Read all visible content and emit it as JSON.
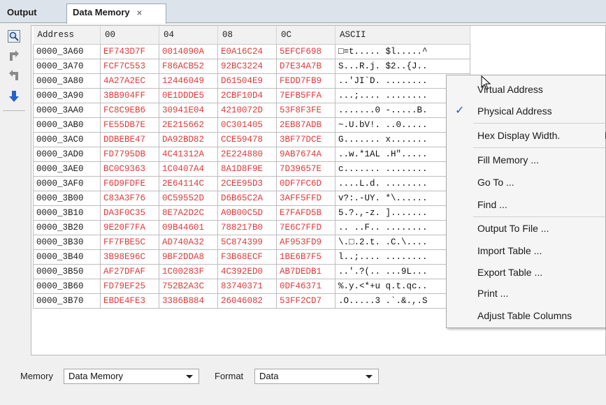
{
  "tabs": [
    {
      "label": "Output"
    },
    {
      "label": "Data Memory"
    }
  ],
  "close_glyph": "✕",
  "table": {
    "headers": [
      "Address",
      "00",
      "04",
      "08",
      "0C",
      "ASCII"
    ],
    "rows": [
      {
        "address": "0000_3A60",
        "c00": "EF743D7F",
        "c04": "0014090A",
        "c08": "E0A16C24",
        "c0c": "5EFCF698",
        "ascii": "□=t..... $l.....^"
      },
      {
        "address": "0000_3A70",
        "c00": "FCF7C553",
        "c04": "F86ACB52",
        "c08": "92BC3224",
        "c0c": "D7E34A7B",
        "ascii": "S...R.j. $2..{J.."
      },
      {
        "address": "0000_3A80",
        "c00": "4A27A2EC",
        "c04": "12446049",
        "c08": "D61504E9",
        "c0c": "FEDD7FB9",
        "ascii": "..'JI`D. ........"
      },
      {
        "address": "0000_3A90",
        "c00": "3BB904FF",
        "c04": "0E1DDDE5",
        "c08": "2CBF10D4",
        "c0c": "7EFB5FFA",
        "ascii": "...;.... ........"
      },
      {
        "address": "0000_3AA0",
        "c00": "FC8C9EB6",
        "c04": "30941E04",
        "c08": "4210072D",
        "c0c": "53F8F3FE",
        "ascii": ".......0 -.....B."
      },
      {
        "address": "0000_3AB0",
        "c00": "FE55DB7E",
        "c04": "2E215662",
        "c08": "0C301405",
        "c0c": "2EB87ADB",
        "ascii": "~.U.bV!. ..0....."
      },
      {
        "address": "0000_3AC0",
        "c00": "DDBEBE47",
        "c04": "DA92BD82",
        "c08": "CCE59478",
        "c0c": "3BF77DCE",
        "ascii": "G....... x......."
      },
      {
        "address": "0000_3AD0",
        "c00": "FD7795DB",
        "c04": "4C41312A",
        "c08": "2E224880",
        "c0c": "9AB7674A",
        "ascii": "..w.*1AL .H\"....."
      },
      {
        "address": "0000_3AE0",
        "c00": "BC0C9363",
        "c04": "1C0407A4",
        "c08": "8A1D8F9E",
        "c0c": "7D39657E",
        "ascii": "c....... ........"
      },
      {
        "address": "0000_3AF0",
        "c00": "F6D9FDFE",
        "c04": "2E64114C",
        "c08": "2CEE95D3",
        "c0c": "0DF7FC6D",
        "ascii": "....L.d. ........"
      },
      {
        "address": "0000_3B00",
        "c00": "C83A3F76",
        "c04": "0C59552D",
        "c08": "D6B65C2A",
        "c0c": "3AFF5FFD",
        "ascii": "v?:.-UY. *\\......"
      },
      {
        "address": "0000_3B10",
        "c00": "DA3F0C35",
        "c04": "8E7A2D2C",
        "c08": "A0B00C5D",
        "c0c": "E7FAFD5B",
        "ascii": "5.?.,-z. ]......."
      },
      {
        "address": "0000_3B20",
        "c00": "9E20F7FA",
        "c04": "09B44601",
        "c08": "788217B0",
        "c0c": "7E6C7FFD",
        "ascii": ".. ..F.. ........"
      },
      {
        "address": "0000_3B30",
        "c00": "FF7FBE5C",
        "c04": "AD740A32",
        "c08": "5C874399",
        "c0c": "AF953FD9",
        "ascii": "\\.□.2.t. .C.\\...."
      },
      {
        "address": "0000_3B40",
        "c00": "3B98E96C",
        "c04": "9BF2DDA8",
        "c08": "F3B68ECF",
        "c0c": "1BE6B7F5",
        "ascii": "l..;.... ........"
      },
      {
        "address": "0000_3B50",
        "c00": "AF27DFAF",
        "c04": "1C00283F",
        "c08": "4C392ED0",
        "c0c": "AB7DEDB1",
        "ascii": "..'.?(.. ...9L..."
      },
      {
        "address": "0000_3B60",
        "c00": "FD79EF25",
        "c04": "752B2A3C",
        "c08": "83740371",
        "c0c": "0DF46371",
        "ascii": "%.y.<*+u q.t.qc.."
      },
      {
        "address": "0000_3B70",
        "c00": "EBDE4FE3",
        "c04": "3386B884",
        "c08": "26046082",
        "c0c": "53FF2CD7",
        "ascii": ".O.....3 .`.&.,.S"
      }
    ]
  },
  "context_menu": {
    "items": [
      {
        "label": "Virtual Address",
        "checked": false
      },
      {
        "label": "Physical Address",
        "checked": true
      },
      {
        "label": "Hex Display Width.",
        "checked": false,
        "submenu": true
      },
      {
        "label": "Fill Memory ...",
        "checked": false
      },
      {
        "label": "Go To ...",
        "checked": false
      },
      {
        "label": "Find ...",
        "checked": false
      },
      {
        "label": "Output To File ...",
        "checked": false
      },
      {
        "label": "Import Table ...",
        "checked": false
      },
      {
        "label": "Export Table ...",
        "checked": false
      },
      {
        "label": "Print ...",
        "checked": false
      },
      {
        "label": "Adjust Table Columns",
        "checked": false
      }
    ],
    "check_glyph": "✓"
  },
  "bottom": {
    "memory_label": "Memory",
    "memory_value": "Data Memory",
    "format_label": "Format",
    "format_value": "Data"
  },
  "toolbar_icons": [
    "magnifier-icon",
    "arrow-right-icon",
    "arrow-left-icon",
    "arrow-down-icon"
  ],
  "colors": {
    "hex_values": "#e03a3a",
    "check": "#1f5fbf",
    "arrow_blue": "#2860c8",
    "arrow_gray": "#8a8a8a"
  }
}
